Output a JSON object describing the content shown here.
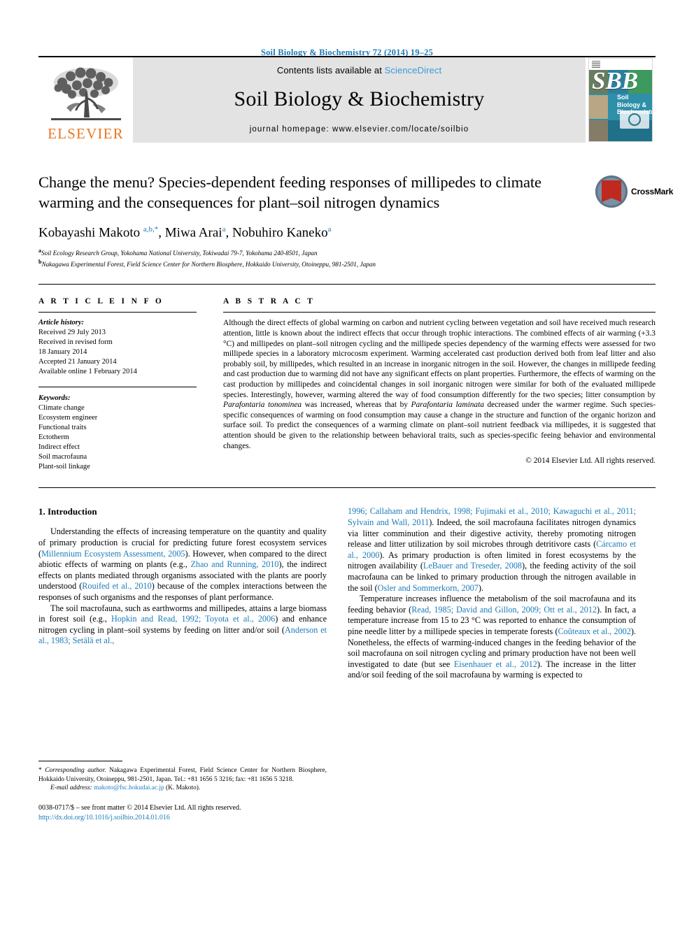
{
  "running_head": "Soil Biology & Biochemistry 72 (2014) 19–25",
  "banner": {
    "contents_prefix": "Contents lists available at ",
    "sciencedirect": "ScienceDirect",
    "journal_name": "Soil Biology & Biochemistry",
    "homepage": "journal homepage: www.elsevier.com/locate/soilbio",
    "publisher_wordmark": "ELSEVIER",
    "cover": {
      "letters": "SBB",
      "title": "Soil Biology & Biochemistry"
    }
  },
  "article": {
    "title": "Change the menu? Species-dependent feeding responses of millipedes to climate warming and the consequences for plant–soil nitrogen dynamics",
    "authors_html": "Kobayashi Makoto <sup>a,b,</sup><sup>*</sup>, Miwa Arai<sup>a</sup>, Nobuhiro Kaneko<sup>a</sup>",
    "affiliations": [
      {
        "marker": "a",
        "text": "Soil Ecology Research Group, Yokohama National University, Tokiwadai 79-7, Yokohama 240-8501, Japan"
      },
      {
        "marker": "b",
        "text": "Nakagawa Experimental Forest, Field Science Center for Northern Biosphere, Hokkaido University, Otoineppu, 981-2501, Japan"
      }
    ],
    "crossmark_label": "CrossMark"
  },
  "article_info": {
    "heading": "A R T I C L E   I N F O",
    "history_label": "Article history:",
    "history": [
      "Received 29 July 2013",
      "Received in revised form",
      "18 January 2014",
      "Accepted 21 January 2014",
      "Available online 1 February 2014"
    ],
    "keywords_label": "Keywords:",
    "keywords": [
      "Climate change",
      "Ecosystem engineer",
      "Functional traits",
      "Ectotherm",
      "Indirect effect",
      "Soil macrofauna",
      "Plant-soil linkage"
    ]
  },
  "abstract": {
    "heading": "A B S T R A C T",
    "text_html": "Although the direct effects of global warming on carbon and nutrient cycling between vegetation and soil have received much research attention, little is known about the indirect effects that occur through trophic interactions. The combined effects of air warming (+3.3 °C) and millipedes on plant–soil nitrogen cycling and the millipede species dependency of the warming effects were assessed for two millipede species in a laboratory microcosm experiment. Warming accelerated cast production derived both from leaf litter and also probably soil, by millipedes, which resulted in an increase in inorganic nitrogen in the soil. However, the changes in millipede feeding and cast production due to warming did not have any significant effects on plant properties. Furthermore, the effects of warming on the cast production by millipedes and coincidental changes in soil inorganic nitrogen were similar for both of the evaluated millipede species. Interestingly, however, warming altered the way of food consumption differently for the two species; litter consumption by <i>Parafontaria tonominea</i> was increased, whereas that by <i>Parafontaria laminata</i> decreased under the warmer regime. Such species-specific consequences of warming on food consumption may cause a change in the structure and function of the organic horizon and surface soil. To predict the consequences of a warming climate on plant–soil nutrient feedback via millipedes, it is suggested that attention should be given to the relationship between behavioral traits, such as species-specific feeing behavior and environmental changes.",
    "copyright": "© 2014 Elsevier Ltd. All rights reserved."
  },
  "introduction": {
    "number_title": "1.  Introduction",
    "left_paragraphs_html": [
      "Understanding the effects of increasing temperature on the quantity and quality of primary production is crucial for predicting future forest ecosystem services (<span class=\"link\">Millennium Ecosystem Assessment, 2005</span>). However, when compared to the direct abiotic effects of warming on plants (e.g., <span class=\"link\">Zhao and Running, 2010</span>), the indirect effects on plants mediated through organisms associated with the plants are poorly understood (<span class=\"link\">Rouifed et al., 2010</span>) because of the complex interactions between the responses of such organisms and the responses of plant performance.",
      "The soil macrofauna, such as earthworms and millipedes, attains a large biomass in forest soil (e.g., <span class=\"link\">Hopkin and Read, 1992; Toyota et al., 2006</span>) and enhance nitrogen cycling in plant–soil systems by feeding on litter and/or soil (<span class=\"link\">Anderson et al., 1983; Setälä et al.,</span>"
    ],
    "right_paragraphs_html": [
      "<span class=\"link\">1996; Callaham and Hendrix, 1998; Fujimaki et al., 2010; Kawaguchi et al., 2011; Sylvain and Wall, 2011</span>). Indeed, the soil macrofauna facilitates nitrogen dynamics via litter comminution and their digestive activity, thereby promoting nitrogen release and litter utilization by soil microbes through detritivore casts (<span class=\"link\">Cárcamo et al., 2000</span>). As primary production is often limited in forest ecosystems by the nitrogen availability (<span class=\"link\">LeBauer and Treseder, 2008</span>), the feeding activity of the soil macrofauna can be linked to primary production through the nitrogen available in the soil (<span class=\"link\">Osler and Sommerkorn, 2007</span>).",
      "Temperature increases influence the metabolism of the soil macrofauna and its feeding behavior (<span class=\"link\">Read, 1985; David and Gillon, 2009; Ott et al., 2012</span>). In fact, a temperature increase from 15 to 23 °C was reported to enhance the consumption of pine needle litter by a millipede species in temperate forests (<span class=\"link\">Coûteaux et al., 2002</span>). Nonetheless, the effects of warming-induced changes in the feeding behavior of the soil macrofauna on soil nitrogen cycling and primary production have not been well investigated to date (but see <span class=\"link\">Eisenhauer et al., 2012</span>). The increase in the litter and/or soil feeding of the soil macrofauna by warming is expected to"
    ]
  },
  "footnote": {
    "text_html": "* <span class=\"ital\">Corresponding author.</span> Nakagawa Experimental Forest, Field Science Center for Northern Biosphere, Hokkaido University, Otoineppu, 981-2501, Japan. Tel.: +81 1656 5 3216; fax: +81 1656 5 3218.",
    "email_label": "E-mail address:",
    "email": "makoto@fsc.hokudai.ac.jp",
    "email_owner": "(K. Makoto)."
  },
  "imprint": {
    "line1": "0038-0717/$ – see front matter © 2014 Elsevier Ltd. All rights reserved.",
    "doi": "http://dx.doi.org/10.1016/j.soilbio.2014.01.016"
  },
  "colors": {
    "link": "#1a7bb9",
    "elsevier_orange": "#E87722",
    "banner_bg": "#e3e3e3"
  }
}
